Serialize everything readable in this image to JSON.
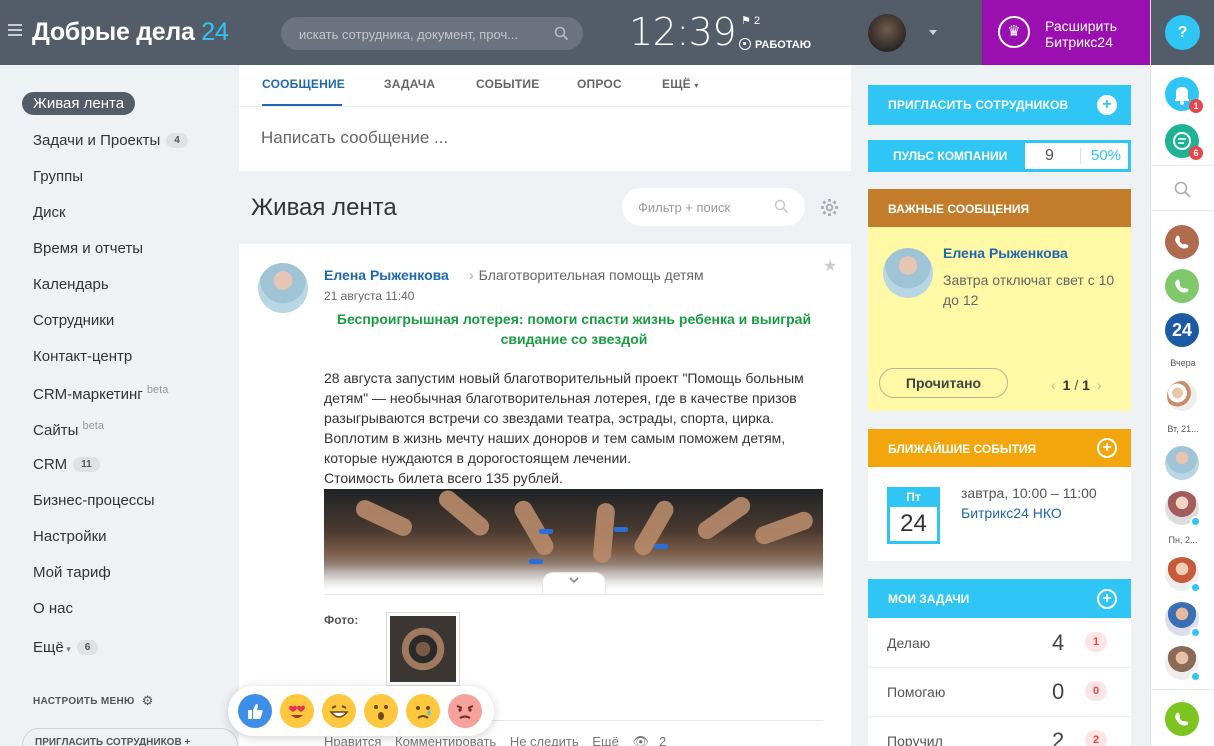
{
  "header": {
    "logo_main": "Добрые дела",
    "logo_num": "24",
    "search_placeholder": "искать сотрудника, документ, проч...",
    "time": "12:39",
    "flag_count": "2",
    "work_status": "РАБОТАЮ",
    "expand_line1": "Расширить",
    "expand_line2": "Битрикс24"
  },
  "strip": {
    "help": "?",
    "notif_count": "1",
    "chat_count": "6",
    "b24": "24",
    "label_yesterday": "Вчера",
    "label_tue": "Вт, 21...",
    "label_mon": "Пн, 2..."
  },
  "menu": {
    "items": [
      {
        "label": "Живая лента"
      },
      {
        "label": "Задачи и Проекты",
        "count": "4"
      },
      {
        "label": "Группы"
      },
      {
        "label": "Диск"
      },
      {
        "label": "Время и отчеты"
      },
      {
        "label": "Календарь"
      },
      {
        "label": "Сотрудники"
      },
      {
        "label": "Контакт-центр"
      },
      {
        "label": "CRM-маркетинг",
        "sup": "beta"
      },
      {
        "label": "Сайты",
        "sup": "beta"
      },
      {
        "label": "CRM",
        "count": "11"
      },
      {
        "label": "Бизнес-процессы"
      },
      {
        "label": "Настройки"
      },
      {
        "label": "Мой тариф"
      },
      {
        "label": "О нас"
      },
      {
        "label": "Ещё",
        "count": "6"
      }
    ],
    "configure": "НАСТРОИТЬ МЕНЮ",
    "invite": "ПРИГЛАСИТЬ СОТРУДНИКОВ"
  },
  "composer": {
    "tabs": [
      "СООБЩЕНИЕ",
      "ЗАДАЧА",
      "СОБЫТИЕ",
      "ОПРОС",
      "ЕЩЁ"
    ],
    "placeholder": "Написать сообщение ..."
  },
  "feed": {
    "title": "Живая лента",
    "filter_placeholder": "Фильтр + поиск"
  },
  "post": {
    "author": "Елена Рыженкова",
    "destination": "Благотворительная помощь детям",
    "date": "21 августа 11:40",
    "title": "Беспроигрышная лотерея: помоги спасти жизнь ребенка и выиграй свидание со звездой",
    "body": "28 августа запустим новый благотворительный проект \"Помощь больным детям\" — необычная благотворительная лотерея, где в качестве призов разыгрываются встречи со звездами театра, эстрады, спорта, цирка. Воплотим в жизнь мечту  наших доноров и тем самым поможем детям, которые нуждаются в дорогостоящем лечении.",
    "price": "Стоимость билета всего 135 рублей.",
    "photo_label": "Фото:",
    "actions": {
      "like": "Нравится",
      "comment": "Комментировать",
      "unfollow": "Не следить",
      "more": "Ещё",
      "views": "2"
    }
  },
  "reactions": [
    "like",
    "love",
    "laugh",
    "wonder",
    "cry",
    "angry"
  ],
  "right": {
    "invite": "ПРИГЛАСИТЬ СОТРУДНИКОВ",
    "pulse_label": "ПУЛЬС КОМПАНИИ",
    "pulse_value": "9",
    "pulse_percent": "50%",
    "important": {
      "title": "ВАЖНЫЕ СООБЩЕНИЯ",
      "author": "Елена Рыженкова",
      "text": "Завтра отключат свет с 10 до 12",
      "button": "Прочитано",
      "page": "1",
      "total": "1"
    },
    "events": {
      "title": "БЛИЖАЙШИЕ СОБЫТИЯ",
      "day_name": "Пт",
      "day": "24",
      "when": "завтра, 10:00 – 11:00",
      "what": "Битрикс24 НКО"
    },
    "tasks": {
      "title": "МОИ ЗАДАЧИ",
      "rows": [
        {
          "label": "Делаю",
          "count": "4",
          "badge": "1"
        },
        {
          "label": "Помогаю",
          "count": "0",
          "badge": "0"
        },
        {
          "label": "Поручил",
          "count": "2",
          "badge": "2"
        }
      ]
    }
  },
  "colors": {
    "header": "#535c69",
    "accent": "#2fc6f6",
    "link": "#2067b0",
    "expand": "#9b0fb0",
    "important": "#c27c2a",
    "events": "#f2a60b"
  }
}
